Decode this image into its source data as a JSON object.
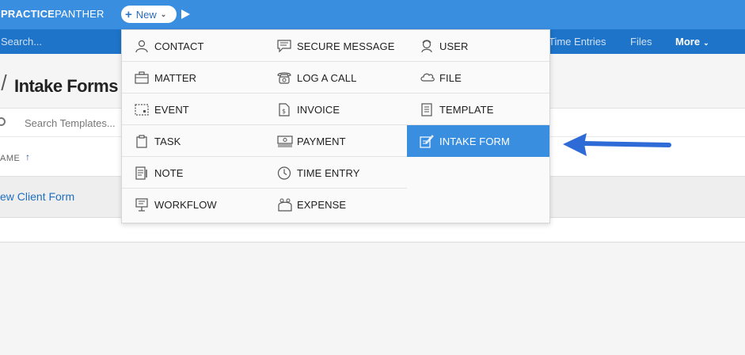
{
  "topbar": {
    "brand_bold": "PRACTICE",
    "brand_light": "PANTHER",
    "new_label": "New",
    "new_plus": "+",
    "new_chevron": "⌄"
  },
  "navbar": {
    "search_placeholder": "Search...",
    "items": [
      "Time Entries",
      "Files"
    ],
    "more_label": "More",
    "more_chevron": "⌄"
  },
  "page": {
    "title": "Intake Forms",
    "search_placeholder": "Search Templates...",
    "column_name": "AME",
    "sort_arrow": "↑",
    "rows": [
      "ew Client Form"
    ]
  },
  "dropdown": {
    "columns": [
      [
        "CONTACT",
        "MATTER",
        "EVENT",
        "TASK",
        "NOTE",
        "WORKFLOW"
      ],
      [
        "SECURE MESSAGE",
        "LOG A CALL",
        "INVOICE",
        "PAYMENT",
        "TIME ENTRY",
        "EXPENSE"
      ],
      [
        "USER",
        "FILE",
        "TEMPLATE",
        "INTAKE FORM"
      ]
    ],
    "icons": [
      [
        "contact-icon",
        "matter-icon",
        "event-icon",
        "task-icon",
        "note-icon",
        "workflow-icon"
      ],
      [
        "secure-message-icon",
        "log-call-icon",
        "invoice-icon",
        "payment-icon",
        "time-entry-icon",
        "expense-icon"
      ],
      [
        "user-icon",
        "file-icon",
        "template-icon",
        "intake-form-icon"
      ]
    ],
    "active": "INTAKE FORM"
  },
  "colors": {
    "topbar": "#3a8ee0",
    "navbar": "#1d74c9",
    "active_item": "#3a8ee0",
    "arrow": "#2f6bd6",
    "link": "#1f6fbf"
  }
}
